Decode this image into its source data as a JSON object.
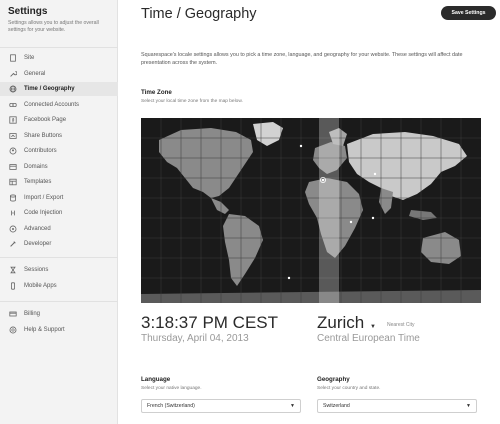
{
  "sidebar": {
    "title": "Settings",
    "description": "Settings allows you to adjust the overall settings for your website.",
    "groups": [
      [
        {
          "label": "Site",
          "icon": "document-icon"
        },
        {
          "label": "General",
          "icon": "wrench-icon"
        },
        {
          "label": "Time / Geography",
          "icon": "globe-icon",
          "active": true
        },
        {
          "label": "Connected Accounts",
          "icon": "link-icon"
        },
        {
          "label": "Facebook Page",
          "icon": "facebook-icon"
        },
        {
          "label": "Share Buttons",
          "icon": "share-icon"
        },
        {
          "label": "Contributors",
          "icon": "person-icon"
        },
        {
          "label": "Domains",
          "icon": "domains-icon"
        },
        {
          "label": "Templates",
          "icon": "template-icon"
        },
        {
          "label": "Import / Export",
          "icon": "database-icon"
        },
        {
          "label": "Code Injection",
          "icon": "code-icon"
        },
        {
          "label": "Advanced",
          "icon": "advanced-icon"
        },
        {
          "label": "Developer",
          "icon": "tools-icon"
        }
      ],
      [
        {
          "label": "Sessions",
          "icon": "hourglass-icon"
        },
        {
          "label": "Mobile Apps",
          "icon": "mobile-icon"
        }
      ],
      [
        {
          "label": "Billing",
          "icon": "card-icon"
        },
        {
          "label": "Help & Support",
          "icon": "help-icon"
        }
      ]
    ]
  },
  "header": {
    "title": "Time / Geography",
    "save_label": "Save Settings"
  },
  "intro": "Squarespace's locale settings allows you to pick a time zone, language, and geography for your website. These settings will affect date presentation across the system.",
  "timezone": {
    "title": "Time Zone",
    "subtitle": "Select your local time zone from the map below.",
    "time": "3:18:37 PM CEST",
    "date": "Thursday, April 04, 2013",
    "city": "Zurich",
    "nearest_label": "Nearest City",
    "zone_name": "Central European Time"
  },
  "language": {
    "title": "Language",
    "subtitle": "Select your native language.",
    "value": "French (Switzerland)"
  },
  "geography": {
    "title": "Geography",
    "subtitle": "Select your country and state.",
    "value": "Switzerland"
  },
  "colors": {
    "accent_dark": "#2b2b2b",
    "sidebar_bg": "#f3f3f3",
    "map_bg": "#1a1a1a"
  }
}
